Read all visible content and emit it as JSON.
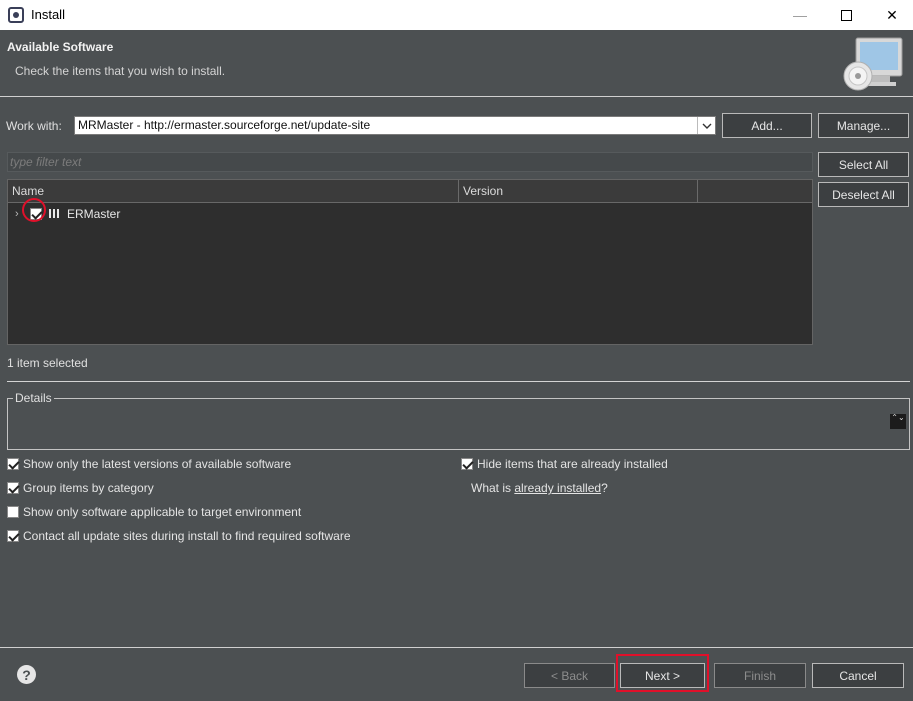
{
  "window": {
    "title": "Install",
    "minimize_icon": "—",
    "close_icon": "✕"
  },
  "banner": {
    "heading": "Available Software",
    "description": "Check the items that you wish to install."
  },
  "work_with": {
    "label": "Work with:",
    "value": "MRMaster - http://ermaster.sourceforge.net/update-site",
    "dropdown_icon": "chevron-down-icon"
  },
  "buttons": {
    "add": "Add...",
    "manage": "Manage...",
    "select_all": "Select All",
    "deselect_all": "Deselect All",
    "back": "< Back",
    "next": "Next >",
    "finish": "Finish",
    "cancel": "Cancel"
  },
  "filter": {
    "placeholder": "type filter text"
  },
  "table": {
    "columns": [
      "Name",
      "Version"
    ],
    "rows": [
      {
        "name": "ERMaster",
        "checked": true,
        "expand_icon": "›"
      }
    ]
  },
  "status": "1 item selected",
  "details": {
    "label": "Details",
    "scroll_icon": "⌃⌄"
  },
  "options": {
    "latest_versions": {
      "label": "Show only the latest versions of available software",
      "checked": true
    },
    "group_by_category": {
      "label": "Group items by category",
      "checked": true
    },
    "applicable_only": {
      "label": "Show only software applicable to target environment",
      "checked": false
    },
    "contact_sites": {
      "label": "Contact all update sites during install to find required software",
      "checked": true
    },
    "hide_installed": {
      "label": "Hide items that are already installed",
      "checked": true
    },
    "what_is_prefix": "What is ",
    "what_is_link": "already installed",
    "what_is_suffix": "?"
  },
  "help": {
    "icon": "?"
  },
  "colors": {
    "background": "#4c5052",
    "link": "#6cb6ff",
    "highlight": "#e0102a"
  }
}
